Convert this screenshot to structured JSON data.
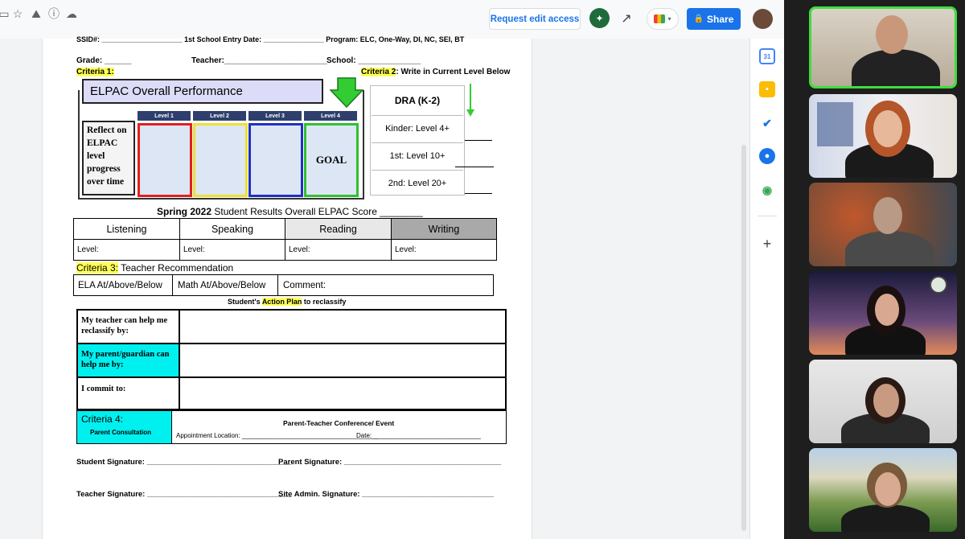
{
  "toolbar": {
    "request_edit_label": "Request edit access",
    "share_label": "Share"
  },
  "form": {
    "top_line": "SSID#: ____________________ 1st School Entry Date: _______________ Program: ELC, One-Way, DI, NC, SEI, BT",
    "grade_label": "Grade: ______",
    "teacher_label": "Teacher:_______________________",
    "school_label": "School: ______________",
    "criteria1": "Criteria 1:",
    "criteria2_tag": "Criteria 2",
    "criteria2_text": ": Write in Current  Level Below",
    "elpac_title": "ELPAC Overall Performance",
    "levels": [
      "Level 1",
      "Level 2",
      "Level 3",
      "Level 4"
    ],
    "reflect_text": "Reflect on ELPAC level progress over time",
    "goal_text": "GOAL",
    "dra_title": "DRA (K-2)",
    "dra_rows": [
      "Kinder: Level 4+",
      "1st: Level 10+",
      "2nd: Level 20+"
    ],
    "spring_title_bold": "Spring 2022",
    "spring_title_rest": " Student Results  Overall ELPAC Score ________",
    "domains": [
      "Listening",
      "Speaking",
      "Reading",
      "Writing"
    ],
    "level_label": "Level:",
    "criteria3_tag": "Criteria 3:",
    "criteria3_text": "  Teacher Recommendation",
    "ela_text": "ELA   At/Above/Below",
    "math_text": "Math    At/Above/Below",
    "comment_text": "Comment:",
    "action_plan_pre": "Student's ",
    "action_plan_tag": "Action Plan",
    "action_plan_post": " to reclassify",
    "plan_rows": [
      "My teacher can help me reclassify by:",
      "My parent/guardian can help me by:",
      "I commit to:"
    ],
    "criteria4_tag": "Criteria 4:",
    "parent_consultation": "Parent Consultation",
    "conference_title": "Parent-Teacher Conference/ Event",
    "appointment_label": "Appointment Location: ______________________________________",
    "date_label": "Date: ______________________________",
    "student_sig": "Student Signature: __________________________________",
    "parent_sig": "Parent Signature: _____________________________________",
    "teacher_sig": "Teacher Signature: __________________________________",
    "admin_sig": "Site Admin. Signature: _______________________________"
  },
  "colors": {
    "share_blue": "#1a73e8",
    "highlight_yellow": "#ffff55",
    "cyan": "#00f0f0",
    "level1": "#e02020",
    "level2": "#f0e030",
    "level3": "#2030c0",
    "level4": "#30c030"
  }
}
